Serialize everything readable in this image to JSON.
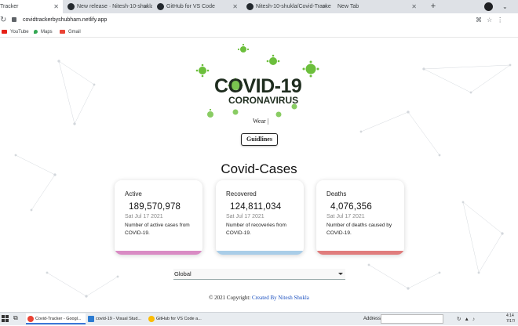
{
  "browser": {
    "tabs": [
      {
        "label": "Tracker",
        "active": true
      },
      {
        "label": "New release · Nitesh-10-shukla/",
        "active": false
      },
      {
        "label": "GitHub for VS Code",
        "active": false
      },
      {
        "label": "Nitesh-10-shukla/Covid-Tracker",
        "active": false
      },
      {
        "label": "New Tab",
        "active": false
      }
    ],
    "new_tab_label": "+",
    "url": "covidtrackerbyshubham.netlify.app",
    "bookmarks": [
      {
        "label": "YouTube",
        "icon": "youtube-icon"
      },
      {
        "label": "Maps",
        "icon": "maps-pin-icon"
      },
      {
        "label": "Gmail",
        "icon": "gmail-icon"
      }
    ]
  },
  "page": {
    "logo_title": "COVID-19",
    "logo_subtitle": "CORONAVIRUS",
    "wear_text": "Wear |",
    "guidelines_label": "Guidlines",
    "cases_title": "Covid-Cases",
    "cards": [
      {
        "title": "Active",
        "value": "189,570,978",
        "date": "Sat Jul 17 2021",
        "desc": "Number of active cases from COVID-19.",
        "color": "#d98bc4"
      },
      {
        "title": "Recovered",
        "value": "124,811,034",
        "date": "Sat Jul 17 2021",
        "desc": "Number of recoveries from COVID-19.",
        "color": "#a9cde8"
      },
      {
        "title": "Deaths",
        "value": "4,076,356",
        "date": "Sat Jul 17 2021",
        "desc": "Number of deaths caused by COVID-19.",
        "color": "#e07c7c"
      }
    ],
    "country_select": "Global",
    "footer_prefix": "© 2021 Copyright: ",
    "footer_link": "Created By Nitesh Shukla"
  },
  "taskbar": {
    "tasks": [
      {
        "label": "Covid-Tracker - Googl...",
        "icon": "chrome-icon",
        "active": true
      },
      {
        "label": "covid-19 - Visual Stud...",
        "icon": "vscode-icon",
        "active": false
      },
      {
        "label": "GitHub for VS Code a...",
        "icon": "chrome-icon",
        "active": false
      }
    ],
    "address_label": "Address",
    "clock_time": "4:14",
    "clock_date": "7/17/"
  },
  "colors": {
    "virus_green": "#6cbf3c",
    "card_active": "#d98bc4",
    "card_recovered": "#a9cde8",
    "card_deaths": "#e07c7c"
  }
}
